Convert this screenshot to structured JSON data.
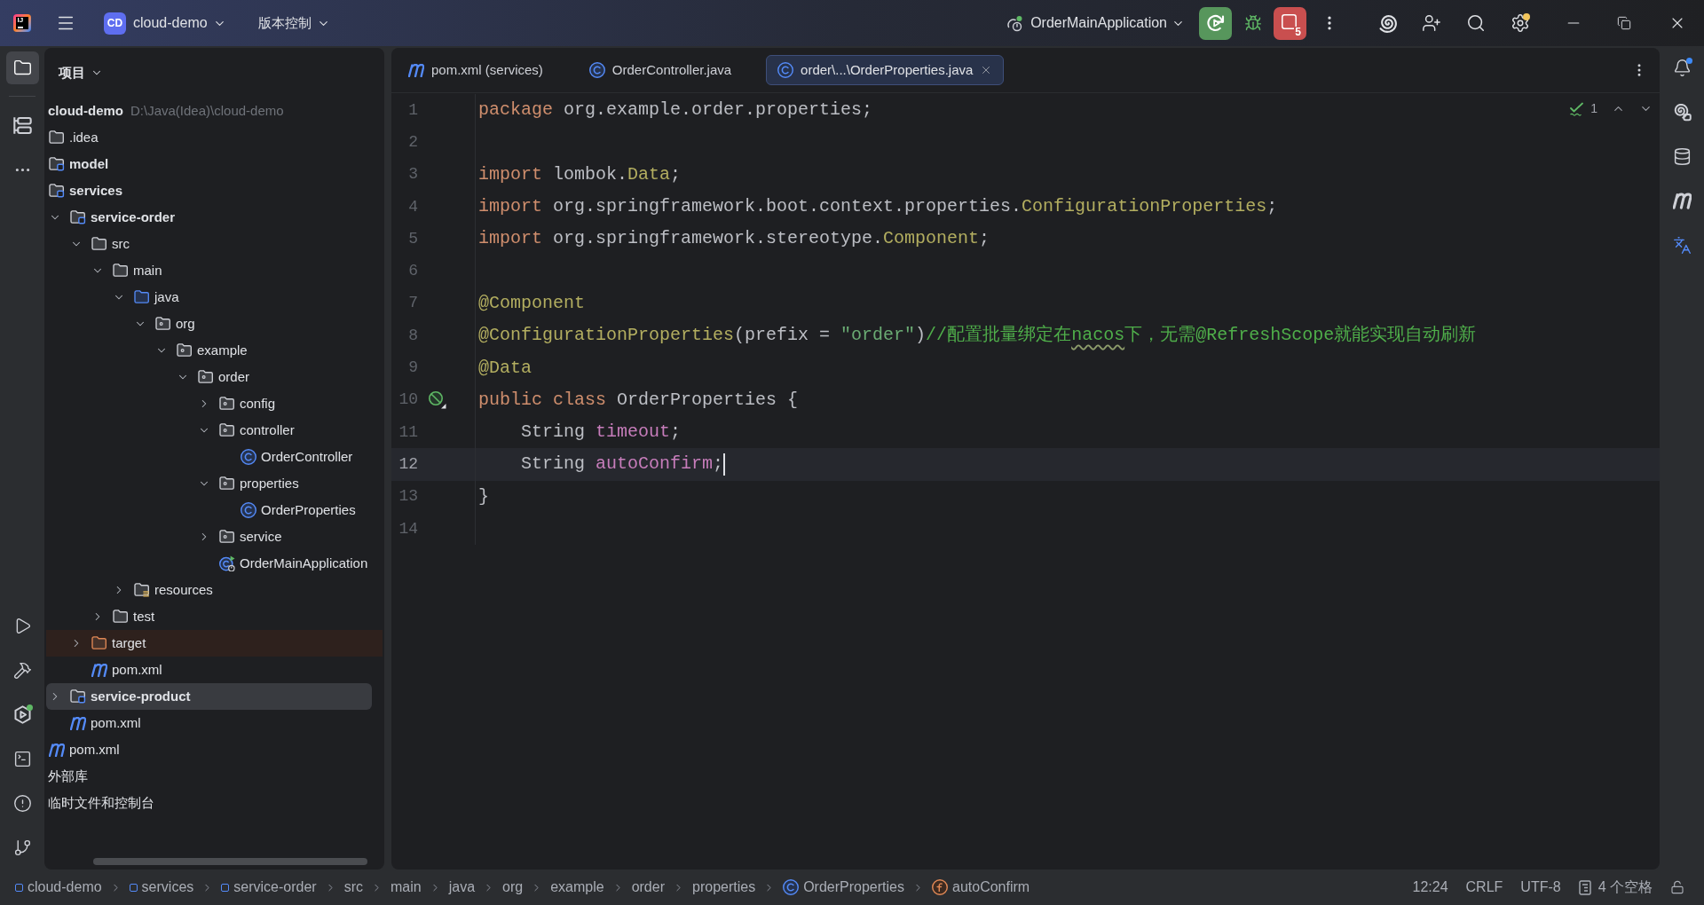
{
  "title_bar": {
    "logo": "IJ",
    "project_badge": "CD",
    "project": "cloud-demo",
    "vcs": "版本控制",
    "run_config": "OrderMainApplication",
    "stop_count": "5",
    "settings_badge": true
  },
  "left_toolbar": {
    "top": [
      {
        "kind": "project",
        "selected": true,
        "badge": false
      },
      {
        "kind": "structure",
        "selected": false,
        "badge": false
      },
      {
        "kind": "more",
        "selected": false,
        "badge": false
      }
    ],
    "bottom": [
      {
        "kind": "run",
        "selected": false,
        "badge": false
      },
      {
        "kind": "build",
        "selected": false,
        "badge": false
      },
      {
        "kind": "services",
        "selected": false,
        "badge": true
      },
      {
        "kind": "terminal",
        "selected": false,
        "badge": false
      },
      {
        "kind": "problems",
        "selected": false,
        "badge": false
      },
      {
        "kind": "git",
        "selected": false,
        "badge": false
      }
    ]
  },
  "project_panel": {
    "title": "项目",
    "tree": [
      {
        "kind": "project",
        "label": "cloud-demo",
        "path": "D:\\Java(Idea)\\cloud-demo",
        "selected": false,
        "children": [
          {
            "kind": "folder",
            "label": ".idea",
            "selected": false
          },
          {
            "kind": "module",
            "label": "model",
            "selected": false
          },
          {
            "kind": "module",
            "label": "services",
            "selected": false,
            "children": [
              {
                "kind": "module",
                "label": "service-order",
                "expanded": true,
                "selected": false,
                "children": [
                  {
                    "kind": "folder",
                    "label": "src",
                    "expanded": true,
                    "selected": false,
                    "children": [
                      {
                        "kind": "folder",
                        "label": "main",
                        "expanded": true,
                        "selected": false,
                        "children": [
                          {
                            "kind": "source",
                            "label": "java",
                            "expanded": true,
                            "selected": false,
                            "children": [
                              {
                                "kind": "package",
                                "label": "org",
                                "expanded": true,
                                "selected": false,
                                "children": [
                                  {
                                    "kind": "package",
                                    "label": "example",
                                    "expanded": true,
                                    "selected": false,
                                    "children": [
                                      {
                                        "kind": "package",
                                        "label": "order",
                                        "expanded": true,
                                        "selected": false,
                                        "children": [
                                          {
                                            "kind": "package",
                                            "label": "config",
                                            "expanded": false,
                                            "selected": false
                                          },
                                          {
                                            "kind": "package",
                                            "label": "controller",
                                            "expanded": true,
                                            "selected": false,
                                            "children": [
                                              {
                                                "kind": "class",
                                                "label": "OrderController",
                                                "selected": false
                                              }
                                            ]
                                          },
                                          {
                                            "kind": "package",
                                            "label": "properties",
                                            "expanded": true,
                                            "selected": false,
                                            "children": [
                                              {
                                                "kind": "class",
                                                "label": "OrderProperties",
                                                "selected": false
                                              }
                                            ]
                                          },
                                          {
                                            "kind": "package",
                                            "label": "service",
                                            "expanded": false,
                                            "selected": false
                                          },
                                          {
                                            "kind": "app",
                                            "label": "OrderMainApplication",
                                            "selected": false
                                          }
                                        ]
                                      }
                                    ]
                                  }
                                ]
                              }
                            ]
                          },
                          {
                            "kind": "resources",
                            "label": "resources",
                            "expanded": false,
                            "selected": false
                          }
                        ]
                      },
                      {
                        "kind": "folder",
                        "label": "test",
                        "expanded": false,
                        "selected": false
                      }
                    ]
                  },
                  {
                    "kind": "excluded",
                    "label": "target",
                    "expanded": false,
                    "selected": false
                  },
                  {
                    "kind": "maven",
                    "label": "pom.xml",
                    "selected": false
                  }
                ]
              },
              {
                "kind": "module",
                "label": "service-product",
                "expanded": false,
                "selected": true
              },
              {
                "kind": "maven",
                "label": "pom.xml",
                "selected": false
              }
            ]
          },
          {
            "kind": "maven",
            "label": "pom.xml",
            "selected": false
          }
        ]
      },
      {
        "kind": "node",
        "label": "外部库",
        "selected": false
      },
      {
        "kind": "node",
        "label": "临时文件和控制台",
        "selected": false
      }
    ]
  },
  "editor": {
    "tabs": [
      {
        "kind": "maven",
        "label": "pom.xml (services)",
        "selected": false
      },
      {
        "kind": "class",
        "label": "OrderController.java",
        "selected": false
      },
      {
        "kind": "class",
        "label": "order\\...\\OrderProperties.java",
        "selected": true
      }
    ],
    "inspection_count": "1",
    "lines": [
      {
        "number": "1",
        "selected": false,
        "tokens": [
          {
            "kind": "keyword",
            "text": "package"
          },
          {
            "kind": "plain",
            "text": " org.example.order.properties;"
          }
        ]
      },
      {
        "number": "2",
        "selected": false
      },
      {
        "number": "3",
        "selected": false,
        "tokens": [
          {
            "kind": "keyword",
            "text": "import"
          },
          {
            "kind": "plain",
            "text": " lombok."
          },
          {
            "kind": "class",
            "text": "Data"
          },
          {
            "kind": "plain",
            "text": ";"
          }
        ]
      },
      {
        "number": "4",
        "selected": false,
        "tokens": [
          {
            "kind": "keyword",
            "text": "import"
          },
          {
            "kind": "plain",
            "text": " org.springframework.boot.context.properties."
          },
          {
            "kind": "class",
            "text": "ConfigurationProperties"
          },
          {
            "kind": "plain",
            "text": ";"
          }
        ]
      },
      {
        "number": "5",
        "selected": false,
        "tokens": [
          {
            "kind": "keyword",
            "text": "import"
          },
          {
            "kind": "plain",
            "text": " org.springframework.stereotype."
          },
          {
            "kind": "class",
            "text": "Component"
          },
          {
            "kind": "plain",
            "text": ";"
          }
        ]
      },
      {
        "number": "6",
        "selected": false
      },
      {
        "number": "7",
        "selected": false,
        "tokens": [
          {
            "kind": "annotation",
            "text": "@Component"
          }
        ]
      },
      {
        "number": "8",
        "selected": false,
        "tokens": [
          {
            "kind": "annotation",
            "text": "@ConfigurationProperties"
          },
          {
            "kind": "plain",
            "text": "(prefix = "
          },
          {
            "kind": "string",
            "text": "\"order\""
          },
          {
            "kind": "plain",
            "text": ")"
          },
          {
            "kind": "comment",
            "text": "//配置批量绑定在"
          },
          {
            "kind": "typo",
            "text": "nacos"
          },
          {
            "kind": "comment",
            "text": "下，无需@RefreshScope就能实现自动刷新"
          }
        ]
      },
      {
        "number": "9",
        "selected": false,
        "tokens": [
          {
            "kind": "annotation",
            "text": "@Data"
          }
        ]
      },
      {
        "number": "10",
        "selected": false,
        "gutter_marker": true,
        "tokens": [
          {
            "kind": "keyword",
            "text": "public class"
          },
          {
            "kind": "plain",
            "text": " OrderProperties {"
          }
        ]
      },
      {
        "number": "11",
        "selected": false,
        "tokens": [
          {
            "kind": "plain",
            "text": "    String "
          },
          {
            "kind": "field",
            "text": "timeout"
          },
          {
            "kind": "plain",
            "text": ";"
          }
        ]
      },
      {
        "number": "12",
        "selected": true,
        "tokens": [
          {
            "kind": "plain",
            "text": "    String "
          },
          {
            "kind": "field",
            "text": "autoConfirm"
          },
          {
            "kind": "plain",
            "text": ";"
          }
        ]
      },
      {
        "number": "13",
        "selected": false,
        "tokens": [
          {
            "kind": "plain",
            "text": "}"
          }
        ]
      },
      {
        "number": "14",
        "selected": false
      }
    ]
  },
  "right_toolbar": {
    "items": [
      {
        "kind": "notifications",
        "selected": false,
        "badge": true
      },
      {
        "kind": "ai-chat",
        "selected": false,
        "badge": false
      },
      {
        "kind": "database",
        "selected": false,
        "badge": false
      },
      {
        "kind": "maven",
        "selected": false,
        "badge": false
      },
      {
        "kind": "translate",
        "selected": false,
        "badge": false
      }
    ]
  },
  "status_bar": {
    "breadcrumbs": [
      {
        "kind": "module",
        "label": "cloud-demo"
      },
      {
        "kind": "module",
        "label": "services"
      },
      {
        "kind": "module",
        "label": "service-order"
      },
      {
        "kind": "plain",
        "label": "src"
      },
      {
        "kind": "plain",
        "label": "main"
      },
      {
        "kind": "plain",
        "label": "java"
      },
      {
        "kind": "plain",
        "label": "org"
      },
      {
        "kind": "plain",
        "label": "example"
      },
      {
        "kind": "plain",
        "label": "order"
      },
      {
        "kind": "plain",
        "label": "properties"
      },
      {
        "kind": "class",
        "label": "OrderProperties"
      },
      {
        "kind": "field",
        "label": "autoConfirm"
      }
    ],
    "caret_position": "12:24",
    "line_separator": "CRLF",
    "encoding": "UTF-8",
    "indent": "4 个空格"
  }
}
